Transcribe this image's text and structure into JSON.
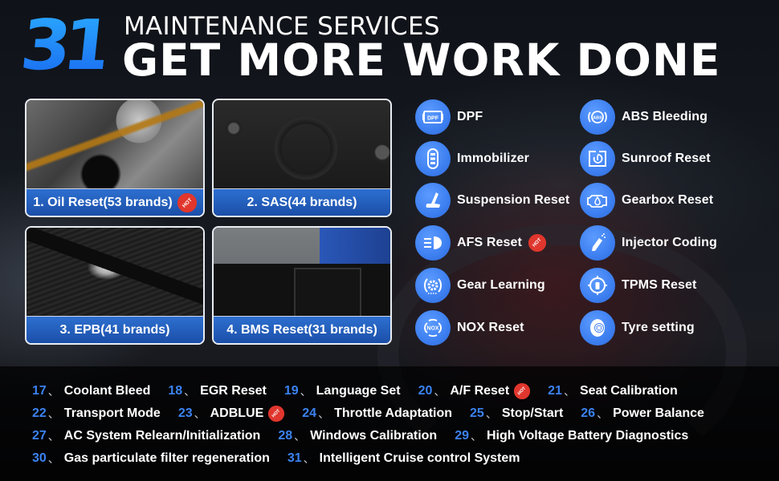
{
  "header": {
    "count": "31",
    "line1": "MAINTENANCE SERVICES",
    "line2": "GET MORE WORK DONE"
  },
  "hot_label": "HOT",
  "cards": [
    {
      "label": "1. Oil Reset(53 brands)",
      "hot": true,
      "photo": "oil-pouring"
    },
    {
      "label": "2. SAS(44 brands)",
      "hot": false,
      "photo": "steering-wheel"
    },
    {
      "label": "3. EPB(41 brands)",
      "hot": false,
      "photo": "parking-brake-button"
    },
    {
      "label": "4. BMS Reset(31 brands)",
      "hot": false,
      "photo": "car-battery"
    }
  ],
  "features_left": [
    {
      "label": "DPF",
      "icon": "dpf-icon",
      "hot": false
    },
    {
      "label": "Immobilizer",
      "icon": "key-fob-icon",
      "hot": false
    },
    {
      "label": "Suspension Reset",
      "icon": "seat-icon",
      "hot": false
    },
    {
      "label": "AFS Reset",
      "icon": "headlight-icon",
      "hot": true
    },
    {
      "label": "Gear Learning",
      "icon": "gear-icon",
      "hot": false
    },
    {
      "label": "NOX Reset",
      "icon": "nox-icon",
      "hot": false
    }
  ],
  "features_right": [
    {
      "label": "ABS Bleeding",
      "icon": "abs-icon",
      "hot": false
    },
    {
      "label": "Sunroof Reset",
      "icon": "sunroof-icon",
      "hot": false
    },
    {
      "label": "Gearbox Reset",
      "icon": "engine-oil-icon",
      "hot": false
    },
    {
      "label": "Injector Coding",
      "icon": "injector-icon",
      "hot": false
    },
    {
      "label": "TPMS Reset",
      "icon": "tpms-icon",
      "hot": false
    },
    {
      "label": "Tyre setting",
      "icon": "tyre-icon",
      "hot": false
    }
  ],
  "more_services": {
    "separator": "、",
    "rows": [
      [
        {
          "num": "17",
          "label": "Coolant Bleed",
          "hot": false
        },
        {
          "num": "18",
          "label": "EGR Reset",
          "hot": false
        },
        {
          "num": "19",
          "label": "Language Set",
          "hot": false
        },
        {
          "num": "20",
          "label": "A/F Reset",
          "hot": true
        },
        {
          "num": "21",
          "label": "Seat Calibration",
          "hot": false
        }
      ],
      [
        {
          "num": "22",
          "label": "Transport Mode",
          "hot": false
        },
        {
          "num": "23",
          "label": "ADBLUE",
          "hot": true
        },
        {
          "num": "24",
          "label": "Throttle Adaptation",
          "hot": false
        },
        {
          "num": "25",
          "label": "Stop/Start",
          "hot": false
        },
        {
          "num": "26",
          "label": "Power Balance",
          "hot": false
        }
      ],
      [
        {
          "num": "27",
          "label": "AC System Relearn/Initialization",
          "hot": false
        },
        {
          "num": "28",
          "label": "Windows Calibration",
          "hot": false
        },
        {
          "num": "29",
          "label": "High Voltage Battery Diagnostics",
          "hot": false
        }
      ],
      [
        {
          "num": "30",
          "label": "Gas particulate filter regeneration",
          "hot": false
        },
        {
          "num": "31",
          "label": "Intelligent Cruise control System",
          "hot": false
        }
      ]
    ]
  },
  "colors": {
    "accent_blue": "#3b82f0",
    "number_gradient_top": "#2aa8ff",
    "number_gradient_bottom": "#1a6cf0",
    "hot_badge": "#e0362d",
    "caption_bar": "#2d6fd0"
  }
}
